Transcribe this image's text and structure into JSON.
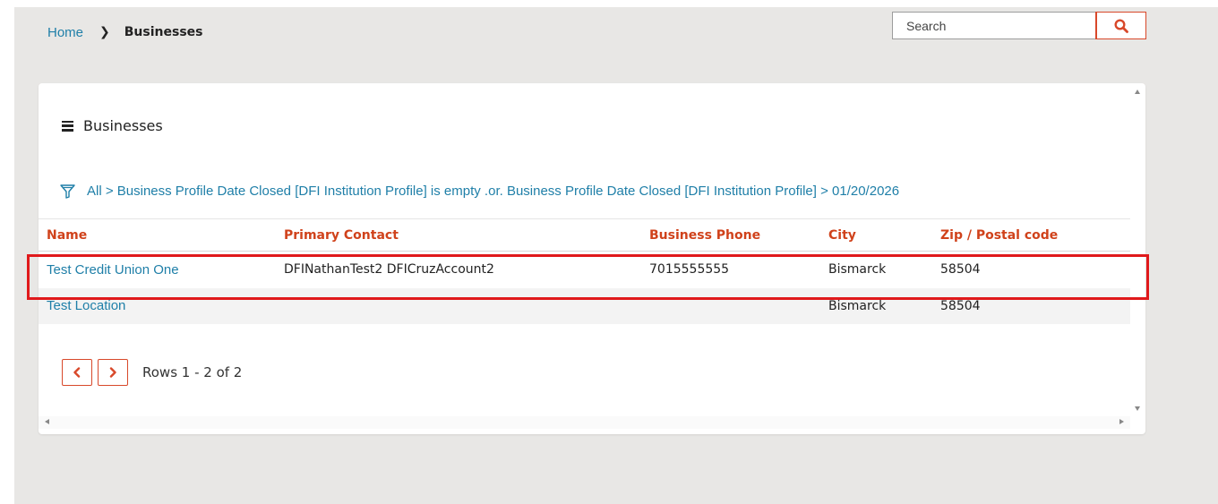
{
  "breadcrumb": {
    "home": "Home",
    "current": "Businesses"
  },
  "search": {
    "placeholder": "Search"
  },
  "panel": {
    "title": "Businesses",
    "filter": "All > Business Profile Date Closed [DFI Institution Profile] is empty .or. Business Profile Date Closed [DFI Institution Profile] > 01/20/2026"
  },
  "table": {
    "columns": [
      "Name",
      "Primary Contact",
      "Business Phone",
      "City",
      "Zip / Postal code"
    ],
    "rows": [
      {
        "name": "Test Credit Union One",
        "contact": "DFINathanTest2 DFICruzAccount2",
        "phone": "7015555555",
        "city": "Bismarck",
        "zip": "58504"
      },
      {
        "name": "Test Location",
        "contact": "",
        "phone": "",
        "city": "Bismarck",
        "zip": "58504"
      }
    ]
  },
  "pager": {
    "text": "Rows 1 - 2 of 2"
  },
  "colors": {
    "accent": "#d8482a",
    "link": "#1f7fa8",
    "highlight": "#e0191b",
    "header": "#d0421b"
  },
  "icons": {
    "search": "search-icon",
    "menu": "hamburger-icon",
    "filter": "filter-icon",
    "prev": "chevron-left-icon",
    "next": "chevron-right-icon"
  }
}
